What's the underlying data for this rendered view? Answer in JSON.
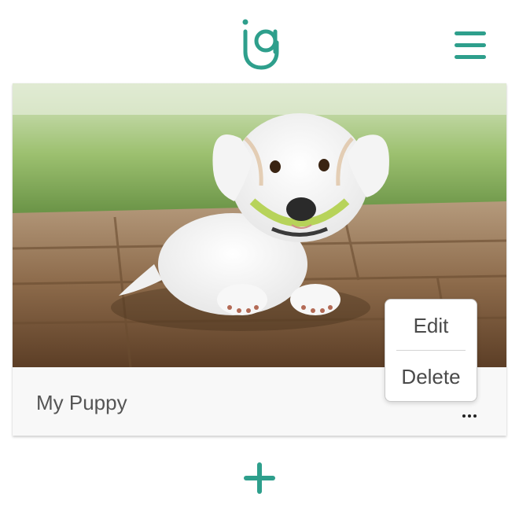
{
  "colors": {
    "accent": "#2e9f8c",
    "card_background": "#f8f8f8",
    "text_muted": "#555555"
  },
  "header": {
    "logo_icon": "ig-logo-icon",
    "menu_icon": "hamburger-menu-icon"
  },
  "post": {
    "image_alt": "white puppy lying on wooden deck",
    "title": "My Puppy",
    "more_icon": "more-options-icon"
  },
  "context_menu": {
    "items": [
      {
        "label": "Edit"
      },
      {
        "label": "Delete"
      }
    ]
  },
  "footer": {
    "add_icon": "plus-icon"
  }
}
